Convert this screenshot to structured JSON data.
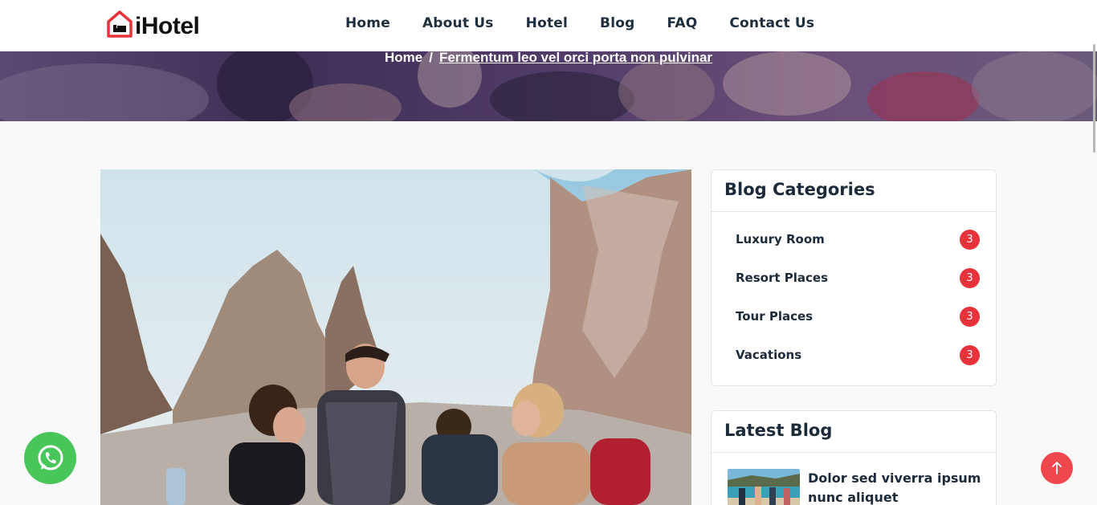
{
  "brand": {
    "name": "iHotel",
    "accent": "#e8323a"
  },
  "nav": {
    "items": [
      "Home",
      "About Us",
      "Hotel",
      "Blog",
      "FAQ",
      "Contact Us"
    ]
  },
  "breadcrumb": {
    "home": "Home",
    "separator": "/",
    "current": "Fermentum leo vel orci porta non pulvinar"
  },
  "sidebar": {
    "categories": {
      "title": "Blog Categories",
      "items": [
        {
          "label": "Luxury Room",
          "count": "3"
        },
        {
          "label": "Resort Places",
          "count": "3"
        },
        {
          "label": "Tour Places",
          "count": "3"
        },
        {
          "label": "Vacations",
          "count": "3"
        }
      ]
    },
    "latest": {
      "title": "Latest Blog",
      "items": [
        {
          "title": "Dolor sed viverra ipsum nunc aliquet"
        }
      ]
    }
  },
  "floating": {
    "whatsapp_icon": "whatsapp-icon",
    "to_top_icon": "arrow-up-icon",
    "whatsapp_color": "#49c65a",
    "to_top_color": "#f0474f"
  }
}
